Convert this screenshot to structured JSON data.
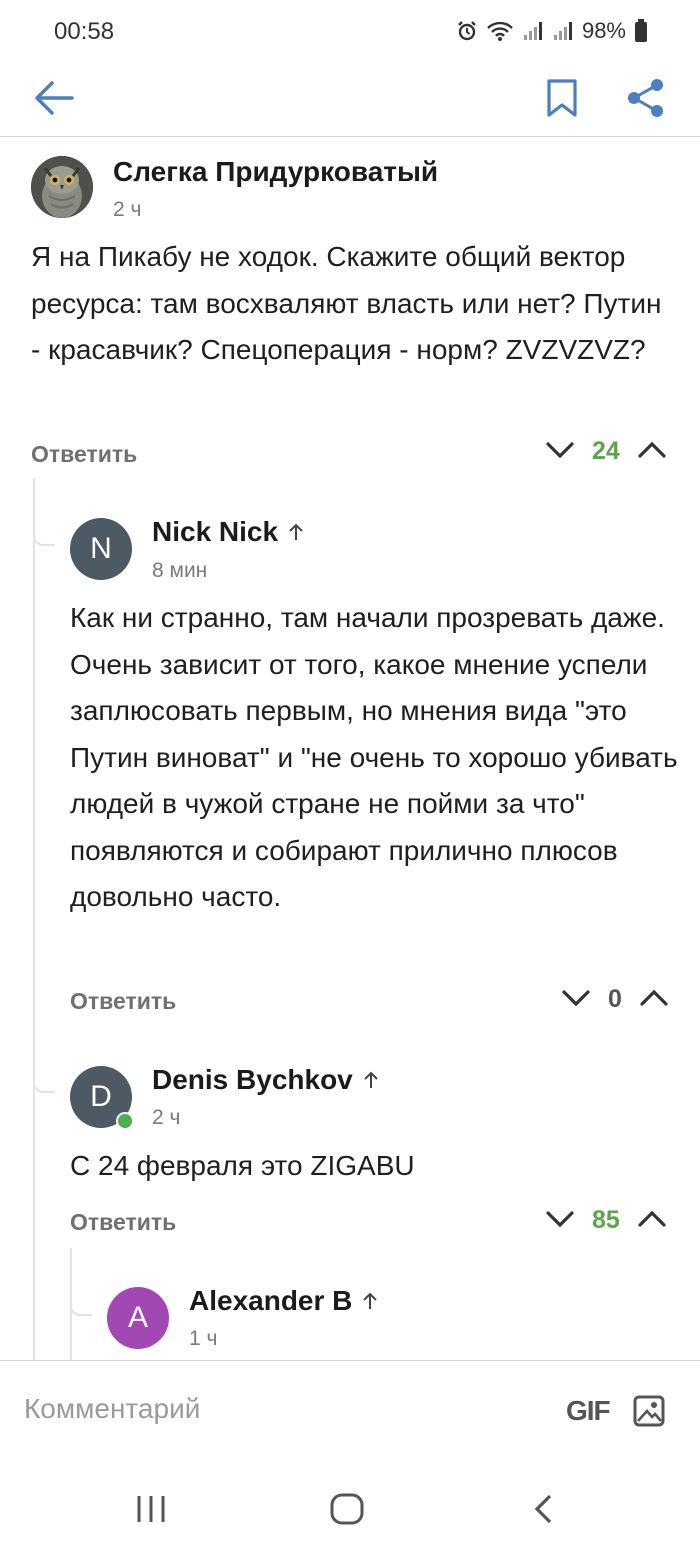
{
  "status_bar": {
    "time": "00:58",
    "battery": "98%"
  },
  "comments": [
    {
      "author": "Слегка Придурковатый",
      "time": "2 ч",
      "text": "Я на Пикабу не ходок. Скажите общий вектор ресурса: там восхваляют власть или нет? Путин - красавчик? Спецоперация - норм? ZVZVZVZ?",
      "reply_label": "Ответить",
      "rating": "24",
      "rating_color": "#5aa64a"
    },
    {
      "author": "Nick Nick",
      "avatar_letter": "N",
      "avatar_color": "#4e5a63",
      "time": "8 мин",
      "text": "Как ни странно, там начали прозревать даже. Очень зависит от того, какое мнение успели заплюсовать первым, но мнения вида \"это Путин виноват\" и \"не очень то хорошо убивать людей в чужой стране не пойми за что\" появляются и собирают прилично плюсов довольно часто.",
      "reply_label": "Ответить",
      "rating": "0",
      "rating_color": "#555555"
    },
    {
      "author": "Denis Bychkov",
      "avatar_letter": "D",
      "avatar_color": "#4e5a63",
      "online_color": "#4caf50",
      "time": "2 ч",
      "text": "С 24 февраля это ZIGABU",
      "reply_label": "Ответить",
      "rating": "85",
      "rating_color": "#5aa64a"
    },
    {
      "author": "Alexander B",
      "avatar_letter": "A",
      "avatar_color": "#a347b5",
      "time": "1 ч"
    }
  ],
  "comment_input": {
    "placeholder": "Комментарий",
    "gif_label": "GIF"
  },
  "icons": {
    "back": "back-arrow-icon",
    "bookmark": "bookmark-icon",
    "share": "share-icon",
    "up_arrow": "arrow-up-icon",
    "vote_down": "chevron-down-icon",
    "vote_up": "chevron-up-icon",
    "image": "image-icon"
  },
  "accent_color": "#4a7fc1"
}
